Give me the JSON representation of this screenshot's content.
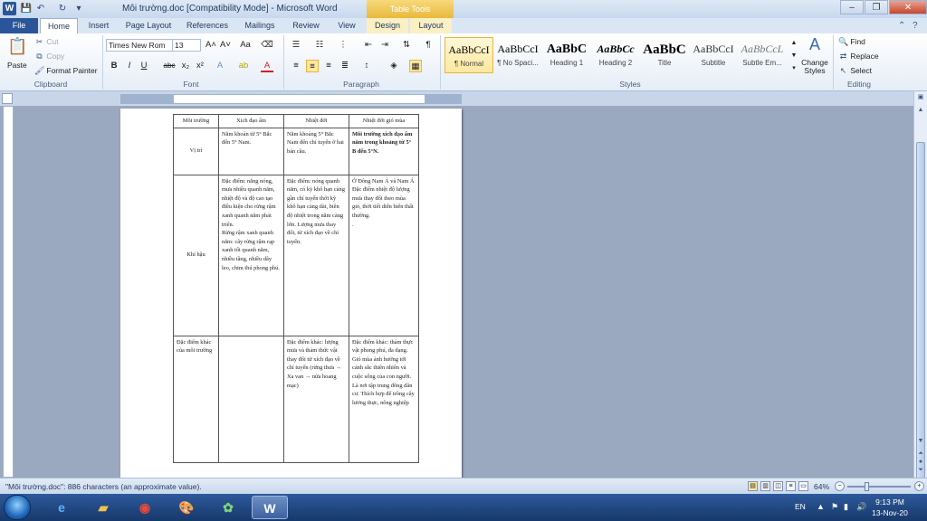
{
  "window": {
    "title": "Môi trường.doc [Compatibility Mode]  -  Microsoft Word",
    "context_tab_title": "Table Tools",
    "minimize": "–",
    "restore": "❐",
    "close": "✕"
  },
  "tabs": [
    "File",
    "Home",
    "Insert",
    "Page Layout",
    "References",
    "Mailings",
    "Review",
    "View",
    "Design",
    "Layout"
  ],
  "clipboard": {
    "paste": "Paste",
    "cut": "Cut",
    "copy": "Copy",
    "format_painter": "Format Painter",
    "label": "Clipboard"
  },
  "font": {
    "family": "Times New Rom",
    "size": "13",
    "label": "Font"
  },
  "paragraph": {
    "label": "Paragraph"
  },
  "styles": {
    "label": "Styles",
    "items": [
      {
        "sample": "AaBbCcI",
        "name": "¶ Normal"
      },
      {
        "sample": "AaBbCcI",
        "name": "¶ No Spaci..."
      },
      {
        "sample": "AaBbC",
        "name": "Heading 1"
      },
      {
        "sample": "AaBbCc",
        "name": "Heading 2"
      },
      {
        "sample": "AaBbC",
        "name": "Title"
      },
      {
        "sample": "AaBbCcI",
        "name": "Subtitle"
      },
      {
        "sample": "AaBbCcL",
        "name": "Subtle Em..."
      }
    ],
    "change_styles": "Change Styles"
  },
  "editing": {
    "find": "Find",
    "replace": "Replace",
    "select": "Select",
    "label": "Editing"
  },
  "table": {
    "headers": [
      "Môi trường",
      "Xích đạo ẩm",
      "Nhiệt đới",
      "Nhiệt đới gió mùa"
    ],
    "rows": [
      {
        "label": "Vị trí",
        "cells": [
          [
            "Nằm khoản từ 5° Bắc đến 5° Nam."
          ],
          [
            "Nằm khoảng 5° Bắc Nam đến chí tuyến ở hai bán cầu."
          ],
          [
            "Môi trường xích đạo ẩm nằm trong khoảng từ 5° B đến 5°N."
          ]
        ]
      },
      {
        "label": "Khí hậu",
        "cells": [
          [
            "Đặc điểm: nắng nóng, mưa nhiều quanh năm, nhiệt độ và độ cao tạo điều kiện cho rừng rậm xanh quanh năm phát triển.",
            "Rừng rậm xanh quanh năm: cây rừng rậm rạp xanh tốt quanh năm, nhiều tầng, nhiều dây leo, chim thú phong phú."
          ],
          [
            "Đặc điểm: nóng quanh năm, có kỳ khô hạn càng gần chí tuyến thời kỳ khô hạn càng dài, biên độ nhiệt trong năm càng lớn. Lượng mưa thay đổi, từ xích đạo về chí tuyến."
          ],
          [
            "Ở Đông Nam Á và Nam Á",
            "Đặc điểm nhiệt độ lượng mưa thay đổi theo mùa gió, thời tiết diễn biến thất thường.",
            "."
          ]
        ]
      },
      {
        "label": "Đặc điểm khác của môi trường",
        "cells": [
          [
            ""
          ],
          [
            "Đặc điểm khác: lượng mưa và thảm thức vật thay đổi từ xích đạo về chí tuyến (rừng thưa → Xa van → nửa hoang mạc)"
          ],
          [
            "Đặc điểm khác: thảm thực vật phong phú, đa dạng. Gió mùa ảnh hưởng tới cảnh sắc thiên nhiên và cuộc sống của con người. Là nơi tập trung đông dân cư. Thích hợp để trồng cây lương thực, nông nghiệp"
          ]
        ]
      }
    ]
  },
  "status": {
    "text": "\"Môi trường.doc\": 886 characters (an approximate value).",
    "zoom": "64%"
  },
  "taskbar": {
    "lang": "EN",
    "time": "9:13 PM",
    "date": "13-Nov-20"
  }
}
